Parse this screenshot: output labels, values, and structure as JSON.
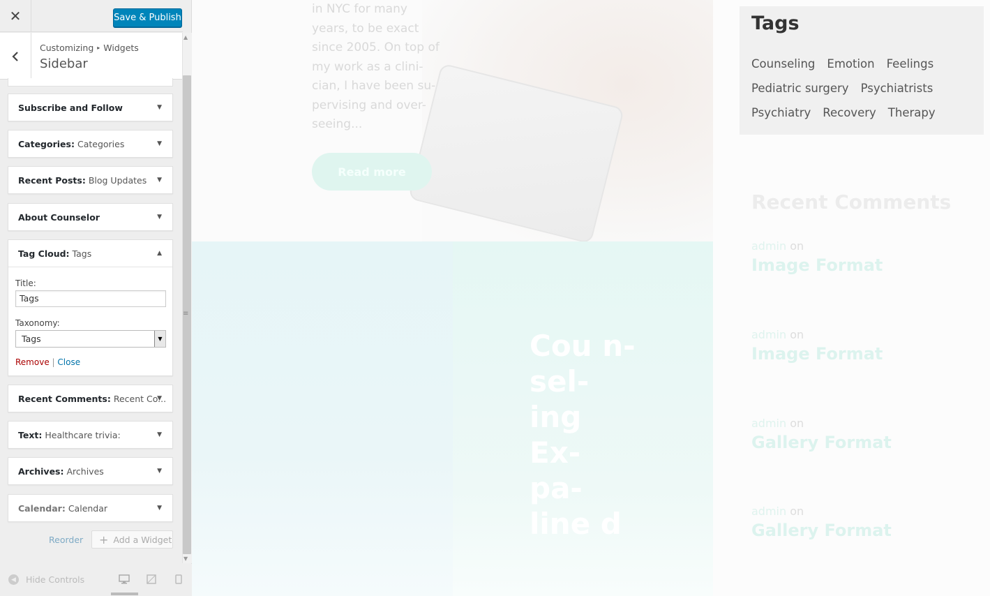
{
  "customizer": {
    "save_label": "Save & Publish",
    "breadcrumb": [
      "Customizing",
      "Widgets"
    ],
    "section_title": "Sidebar",
    "widgets": [
      {
        "name": "Subscribe and Follow",
        "sub": ""
      },
      {
        "name": "Categories:",
        "sub": "Categories"
      },
      {
        "name": "Recent Posts:",
        "sub": "Blog Updates"
      },
      {
        "name": "About Counselor",
        "sub": ""
      },
      {
        "name": "Tag Cloud:",
        "sub": "Tags"
      },
      {
        "name": "Recent Comments:",
        "sub": "Recent Co..."
      },
      {
        "name": "Text:",
        "sub": "Healthcare trivia:"
      },
      {
        "name": "Archives:",
        "sub": "Archives"
      },
      {
        "name": "Calendar:",
        "sub": "Calendar"
      }
    ],
    "tag_cloud_form": {
      "title_label": "Title:",
      "title_value": "Tags",
      "taxonomy_label": "Taxonomy:",
      "taxonomy_value": "Tags",
      "remove_label": "Remove",
      "divider": "|",
      "close_label": "Close"
    },
    "reorder_label": "Reorder",
    "add_widget_label": "Add a Widget",
    "hide_controls_label": "Hide Controls"
  },
  "preview": {
    "excerpt": "in NYC for many years, to be exact since 2005. On top of my work as a clini-cian, I have been su-pervising and over-seeing...",
    "read_more": "Read more",
    "post_title": "Cou n- sel- ing Ex- pa- line d",
    "tags_title": "Tags",
    "tags": [
      "Counseling",
      "Emotion",
      "Feelings",
      "Pediatric surgery",
      "Psychiatrists",
      "Psychiatry",
      "Recovery",
      "Therapy"
    ],
    "recent_comments_title": "Recent Comments",
    "comments": [
      {
        "author": "admin",
        "on": "on",
        "post": "Image Format"
      },
      {
        "author": "admin",
        "on": "on",
        "post": "Image Format"
      },
      {
        "author": "admin",
        "on": "on",
        "post": "Gallery Format"
      },
      {
        "author": "admin",
        "on": "on",
        "post": "Gallery Format"
      }
    ]
  },
  "colors": {
    "primary_button": "#0085ba",
    "remove_link": "#aa0000",
    "close_link": "#0073aa",
    "accent_mint": "#dff5ef"
  }
}
